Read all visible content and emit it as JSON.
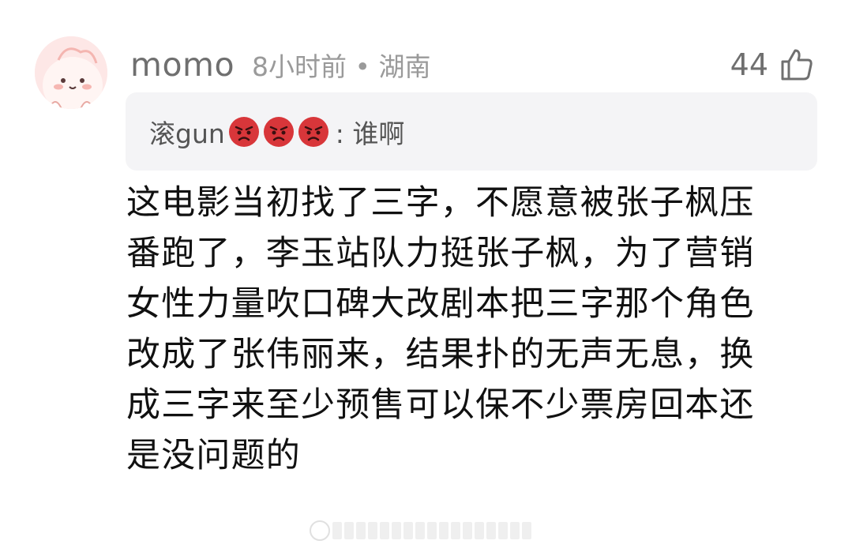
{
  "comment": {
    "username": "momo",
    "meta": "8小时前 • 湖南",
    "like_count": "44",
    "quote": {
      "name": "滚gun",
      "emoji": "angry-face-emoji",
      "text": ": 谁啊"
    },
    "lines": [
      "这电影当初找了三字，不愿意被张子枫压",
      "番跑了，李玉站队力挺张子枫，为了营销",
      "女性力量吹口碑大改剧本把三字那个角色",
      "改成了张伟丽来，结果扑的无声无息，换",
      "成三字来至少预售可以保不少票房回本还",
      "是没问题的"
    ]
  },
  "colors": {
    "avatar_bg": "#fde7e6",
    "quote_bg": "#f4f4f6",
    "emoji_red": "#d8363a",
    "text_primary": "#111111",
    "text_secondary": "#6f6f6f",
    "text_meta": "#9a9a9a"
  }
}
